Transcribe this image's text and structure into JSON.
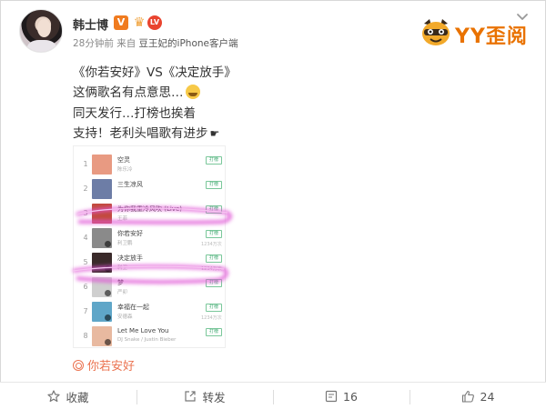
{
  "header": {
    "username": "韩士博",
    "badge_v": "V",
    "badge_level": "LV",
    "meta": "28分钟前 来自 ",
    "meta_source": "豆王妃的iPhone客户端"
  },
  "watermark": {
    "brand": "YY歪阅"
  },
  "post": {
    "line1": "《你若安好》VS《决定放手》",
    "line2": "这俩歌名有点意思…",
    "line3": "同天发行…打榜也挨着",
    "line4": "支持！老利头唱歌有进步",
    "tag": "你若安好"
  },
  "chart_list": {
    "rows": [
      {
        "rank": "1",
        "song": "空灵",
        "artist": "陈乐冷",
        "count": "",
        "thumb_color": "#e89a82"
      },
      {
        "rank": "2",
        "song": "三生凉风",
        "artist": "",
        "count": "",
        "thumb_color": "#6d7da6"
      },
      {
        "rank": "3",
        "song": "为你我重冷风吹 (Live)",
        "artist": "王菲",
        "count": "",
        "thumb_color": "#c24a3e"
      },
      {
        "rank": "4",
        "song": "你若安好",
        "artist": "利卫鹏",
        "count": "1234万次",
        "thumb_color": "#8a8a8a"
      },
      {
        "rank": "5",
        "song": "决定放手",
        "artist": "利卫",
        "count": "1234万次",
        "thumb_color": "#3a2a2a"
      },
      {
        "rank": "6",
        "song": "梦",
        "artist": "严卯",
        "count": "",
        "thumb_color": "#cfcfcf"
      },
      {
        "rank": "7",
        "song": "幸福在一起",
        "artist": "安德森",
        "count": "1234万次",
        "thumb_color": "#5fa6c8"
      },
      {
        "rank": "8",
        "song": "Let Me Love You",
        "artist": "DJ Snake / Justin Bieber",
        "count": "",
        "thumb_color": "#e8b9a0"
      }
    ],
    "button_label": "打榜"
  },
  "footer": {
    "favorite": "收藏",
    "repost": "转发",
    "comments": "16",
    "likes": "24"
  },
  "colors": {
    "accent_orange": "#eb7350",
    "glow_pink": "#e055d6",
    "brand_orange": "#e97200"
  }
}
